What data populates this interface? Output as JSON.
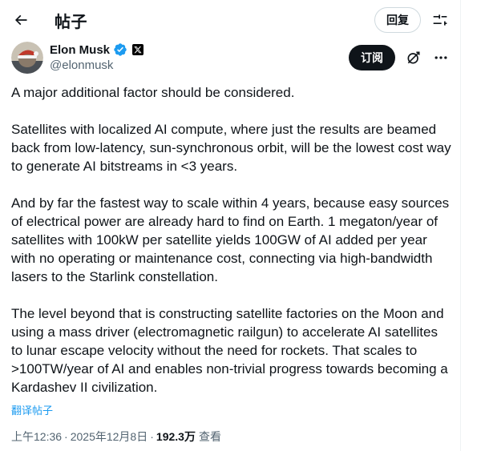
{
  "header": {
    "title": "帖子",
    "reply_label": "回复",
    "back_icon": "back-arrow-icon",
    "tune_icon": "tune-icon"
  },
  "author": {
    "display_name": "Elon Musk",
    "handle": "@elonmusk",
    "verified_color": "#1d9bf0",
    "subscribe_label": "订阅",
    "grok_icon": "grok-icon",
    "more_icon": "more-icon"
  },
  "post": {
    "paragraphs": [
      "A major additional factor should be considered.",
      "Satellites with localized AI compute, where just the results are beamed back from low-latency, sun-synchronous orbit, will be the lowest cost way to generate AI bitstreams in <3 years.",
      "And by far the fastest way to scale within 4 years, because easy sources of electrical power are already hard to find on Earth. 1 megaton/year of satellites with 100kW per satellite yields 100GW of AI added per year with no operating or maintenance cost, connecting via high-bandwidth lasers to the Starlink constellation.",
      "The level beyond that is constructing satellite factories on the Moon and using a mass driver (electromagnetic railgun) to accelerate AI satellites to lunar escape velocity without the need for rockets. That scales to >100TW/year of AI and enables non-trivial progress towards becoming a Kardashev II civilization."
    ],
    "translate_label": "翻译帖子"
  },
  "meta": {
    "time": "上午12:36",
    "separator": "·",
    "date": "2025年12月8日",
    "views_count": "192.3万",
    "views_label": "查看"
  },
  "colors": {
    "accent": "#1d9bf0",
    "text": "#0f1419",
    "secondary": "#536471"
  }
}
